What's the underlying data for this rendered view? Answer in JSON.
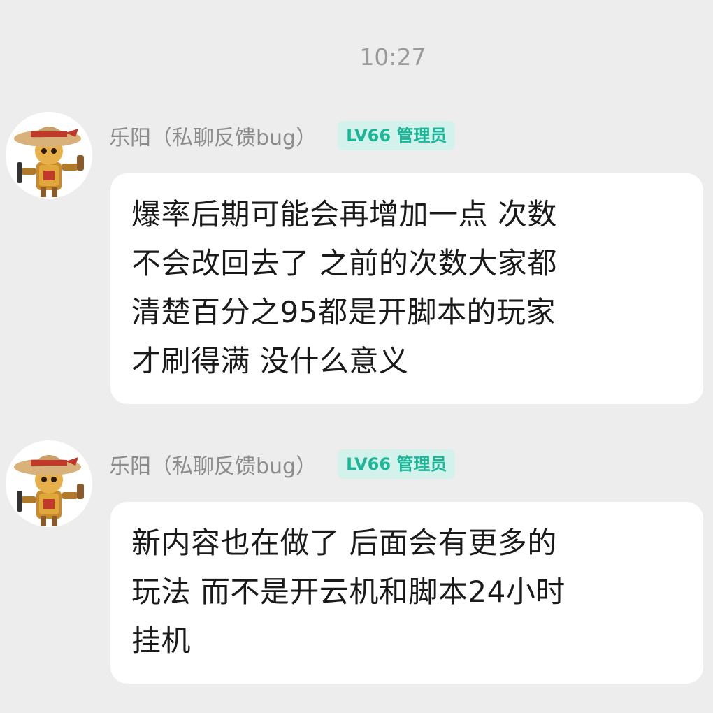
{
  "timestamp": "10:27",
  "messages": [
    {
      "sender": "乐阳（私聊反馈bug）",
      "badge": "LV66 管理员",
      "avatar_icon": "scarecrow-avatar-icon",
      "text": "爆率后期可能会再增加一点 次数\n不会改回去了 之前的次数大家都\n清楚百分之95都是开脚本的玩家\n才刷得满 没什么意义"
    },
    {
      "sender": "乐阳（私聊反馈bug）",
      "badge": "LV66 管理员",
      "avatar_icon": "scarecrow-avatar-icon",
      "text": "新内容也在做了 后面会有更多的\n玩法 而不是开云机和脚本24小时\n挂机"
    }
  ],
  "colors": {
    "background": "#ededed",
    "bubble": "#ffffff",
    "badge_bg": "#d4f2ec",
    "badge_text": "#1bb597",
    "sender_text": "#8c8c8c",
    "timestamp_text": "#9a9a9a"
  }
}
